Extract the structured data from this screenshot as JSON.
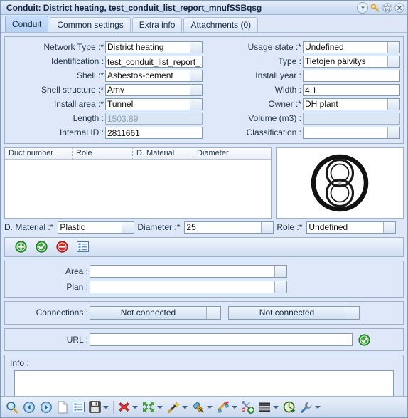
{
  "window": {
    "title": "Conduit: District heating, test_conduit_list_report_mnufSSBqsg",
    "controls": [
      {
        "name": "minimize-dropdown-icon",
        "glyph": "▾"
      },
      {
        "name": "key-icon",
        "glyph": "key"
      },
      {
        "name": "favorite-star-icon",
        "glyph": "star"
      },
      {
        "name": "close-icon",
        "glyph": "×"
      }
    ]
  },
  "tabs": [
    {
      "label": "Conduit",
      "active": true
    },
    {
      "label": "Common settings",
      "active": false
    },
    {
      "label": "Extra info",
      "active": false
    },
    {
      "label": "Attachments (0)",
      "active": false
    }
  ],
  "form": {
    "left": [
      {
        "label": "Network Type :*",
        "type": "combo",
        "value": "District heating",
        "readonly": false
      },
      {
        "label": "Identification :",
        "type": "text",
        "value": "test_conduit_list_report_",
        "readonly": false
      },
      {
        "label": "Shell :*",
        "type": "combo",
        "value": "Asbestos-cement",
        "readonly": false
      },
      {
        "label": "Shell structure :*",
        "type": "combo",
        "value": "Amv",
        "readonly": false
      },
      {
        "label": "Install area :*",
        "type": "combo",
        "value": "Tunnel",
        "readonly": false
      },
      {
        "label": "Length :",
        "type": "text",
        "value": "1503.89",
        "readonly": true
      },
      {
        "label": "Internal ID :",
        "type": "text",
        "value": "2811661",
        "readonly": false
      }
    ],
    "right": [
      {
        "label": "Usage state :*",
        "type": "combo",
        "value": "Undefined",
        "readonly": false
      },
      {
        "label": "Type :",
        "type": "combo",
        "value": "Tietojen päivitys",
        "readonly": false
      },
      {
        "label": "Install year :",
        "type": "text",
        "value": "",
        "readonly": false
      },
      {
        "label": "Width :",
        "type": "text",
        "value": "4.1",
        "readonly": false
      },
      {
        "label": "Owner :*",
        "type": "combo",
        "value": "DH plant",
        "readonly": false
      },
      {
        "label": "Volume (m3) :",
        "type": "text",
        "value": "",
        "readonly": true
      },
      {
        "label": "Classification :",
        "type": "combo",
        "value": "",
        "readonly": false
      }
    ]
  },
  "duct_table": {
    "columns": [
      "Duct number",
      "Role",
      "D. Material",
      "Diameter"
    ],
    "rows": []
  },
  "preview": {
    "name": "conduit-cross-section-diagram"
  },
  "duct_editor": {
    "material_label": "D. Material :*",
    "material_value": "Plastic",
    "diameter_label": "Diameter :*",
    "diameter_value": "25",
    "role_label": "Role :*",
    "role_value": "Undefined"
  },
  "duct_actions": [
    {
      "name": "add-duct-button",
      "icon": "green-plus"
    },
    {
      "name": "accept-duct-button",
      "icon": "green-check"
    },
    {
      "name": "remove-duct-button",
      "icon": "red-minus"
    },
    {
      "name": "duct-list-button",
      "icon": "list"
    }
  ],
  "area_plan": {
    "area_label": "Area :",
    "area_value": "",
    "plan_label": "Plan :",
    "plan_value": ""
  },
  "connections": {
    "label": "Connections :",
    "first": "Not connected",
    "second": "Not connected"
  },
  "url": {
    "label": "URL :",
    "value": "",
    "check_icon": "green-check"
  },
  "info": {
    "label": "Info :",
    "value": ""
  },
  "toolbar": [
    {
      "name": "search-icon",
      "has_arrow": false
    },
    {
      "name": "previous-icon",
      "has_arrow": false
    },
    {
      "name": "next-icon",
      "has_arrow": false
    },
    {
      "name": "new-document-icon",
      "has_arrow": false
    },
    {
      "name": "list-view-icon",
      "has_arrow": false
    },
    {
      "name": "save-icon",
      "has_arrow": true
    },
    {
      "name": "delete-icon",
      "has_arrow": true
    },
    {
      "name": "merge-icon",
      "has_arrow": true
    },
    {
      "name": "magic-wand-icon",
      "has_arrow": true
    },
    {
      "name": "measure-icon",
      "has_arrow": true
    },
    {
      "name": "split-tool-icon",
      "has_arrow": true
    },
    {
      "name": "cut-add-icon",
      "has_arrow": false
    },
    {
      "name": "layers-icon",
      "has_arrow": true
    },
    {
      "name": "refresh-export-icon",
      "has_arrow": false
    },
    {
      "name": "settings-wrench-icon",
      "has_arrow": true
    }
  ],
  "colors": {
    "panel_bg": "#dfe8f8",
    "window_bg": "#dde7f7",
    "accent_tab": "#c9defa",
    "border": "#9bb2cd",
    "text": "#21364d"
  }
}
